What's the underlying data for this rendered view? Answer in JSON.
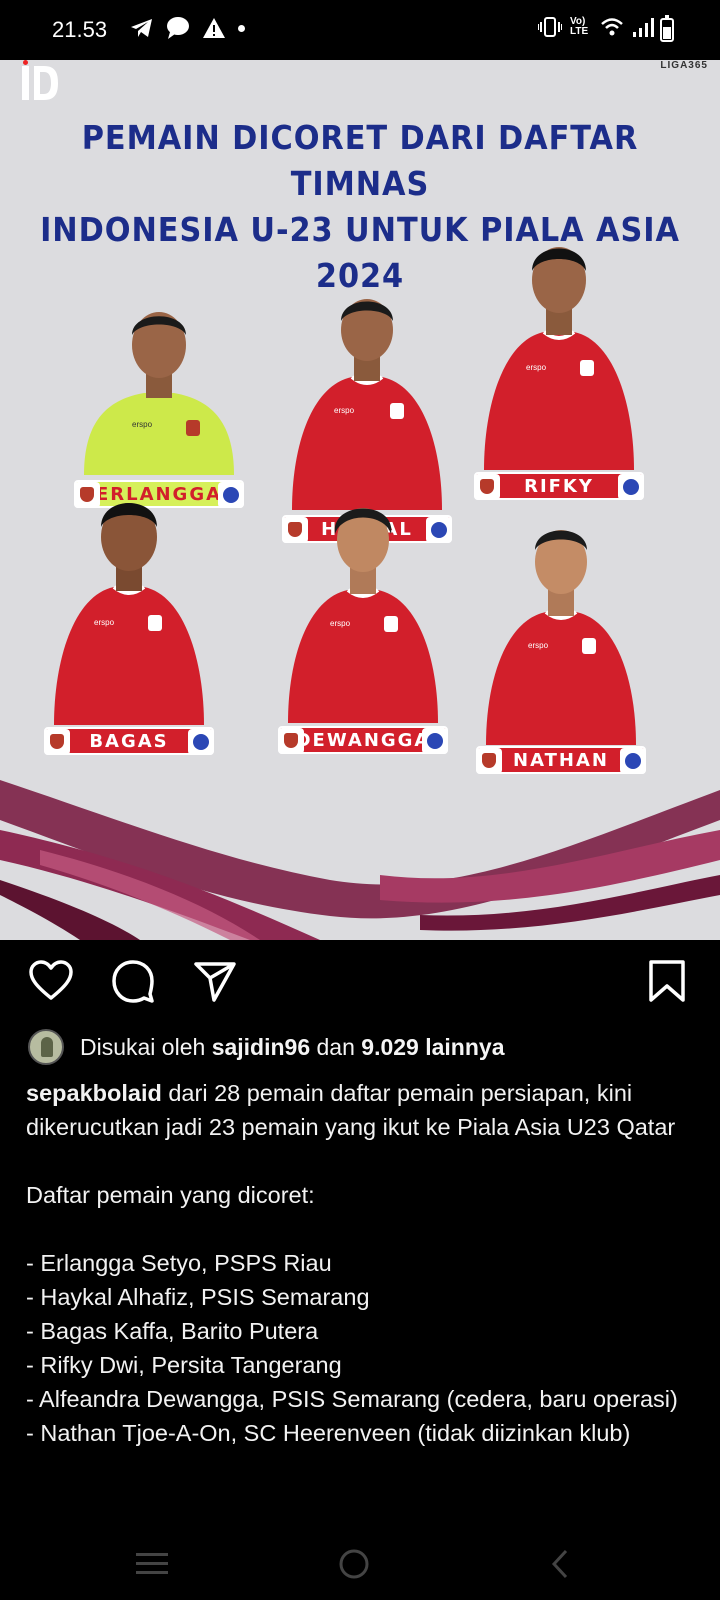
{
  "status_bar": {
    "time": "21.53",
    "left_icons": [
      "telegram-icon",
      "chat-bubble-icon",
      "warning-icon",
      "notification-dot-icon"
    ],
    "right_icons": [
      "vibrate-icon",
      "volte-icon",
      "wifi-icon",
      "signal-icon",
      "battery-icon"
    ],
    "volte_label": "Vo) LTE"
  },
  "post_image": {
    "logo_left": "ID",
    "logo_right": "LIGA365",
    "title_line1": "PEMAIN DICORET DARI DAFTAR TIMNAS",
    "title_line2": "INDONESIA U-23 UNTUK PIALA ASIA 2024",
    "jersey_brand": "erspo",
    "players": [
      {
        "name": "ERLANGGA"
      },
      {
        "name": "HAYKAL"
      },
      {
        "name": "RIFKY"
      },
      {
        "name": "BAGAS"
      },
      {
        "name": "DEWANGGA"
      },
      {
        "name": "NATHAN"
      }
    ],
    "colors": {
      "title": "#1c2d8a",
      "jersey_red": "#d21f2b",
      "keeper_green": "#cde94a",
      "wave": "#7b1f45",
      "background": "#dcdcdf"
    }
  },
  "actions": {
    "like": "heart-icon",
    "comment": "comment-icon",
    "share": "send-icon",
    "save": "bookmark-icon"
  },
  "likes": {
    "prefix": "Disukai oleh",
    "user": "sajidin96",
    "middle": "dan",
    "count": "9.029 lainnya"
  },
  "caption": {
    "username": "sepakbolaid",
    "intro": "dari 28 pemain daftar pemain persiapan, kini dikerucutkan jadi 23 pemain yang ikut ke Piala Asia U23 Qatar",
    "list_header": "Daftar pemain yang dicoret:",
    "items": [
      "- Erlangga Setyo, PSPS Riau",
      "- Haykal Alhafiz, PSIS Semarang",
      "- Bagas Kaffa, Barito Putera",
      "- Rifky Dwi, Persita Tangerang",
      "- Alfeandra Dewangga, PSIS Semarang (cedera, baru operasi)",
      "- Nathan Tjoe-A-On, SC Heerenveen (tidak diizinkan klub)"
    ]
  },
  "navbar": {
    "items": [
      "recents-icon",
      "home-icon",
      "back-icon"
    ]
  }
}
